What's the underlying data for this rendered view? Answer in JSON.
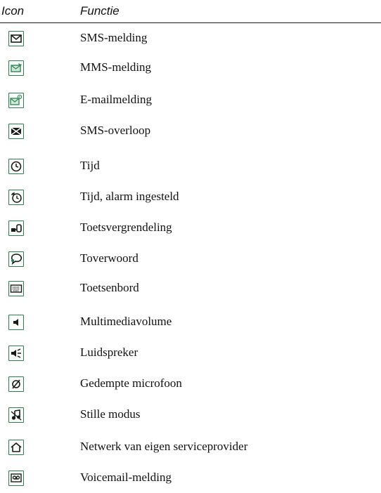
{
  "header": {
    "icon_col": "Icon",
    "function_col": "Functie"
  },
  "rows": [
    {
      "label": "SMS-melding",
      "icon": "sms-icon"
    },
    {
      "label": "MMS-melding",
      "icon": "mms-icon"
    },
    {
      "label": "E-mailmelding",
      "icon": "email-icon"
    },
    {
      "label": "SMS-overloop",
      "icon": "sms-overflow-icon"
    },
    {
      "label": "Tijd",
      "icon": "clock-icon"
    },
    {
      "label": "Tijd, alarm ingesteld",
      "icon": "alarm-icon"
    },
    {
      "label": "Toetsvergrendeling",
      "icon": "keylock-icon"
    },
    {
      "label": "Toverwoord",
      "icon": "magic-word-icon"
    },
    {
      "label": "Toetsenbord",
      "icon": "keyboard-icon"
    },
    {
      "label": "Multimediavolume",
      "icon": "volume-icon"
    },
    {
      "label": "Luidspreker",
      "icon": "speaker-icon"
    },
    {
      "label": "Gedempte microfoon",
      "icon": "muted-mic-icon"
    },
    {
      "label": "Stille modus",
      "icon": "silent-mode-icon"
    },
    {
      "label": "Netwerk van eigen serviceprovider",
      "icon": "home-network-icon"
    },
    {
      "label": "Voicemail-melding",
      "icon": "voicemail-icon"
    }
  ]
}
